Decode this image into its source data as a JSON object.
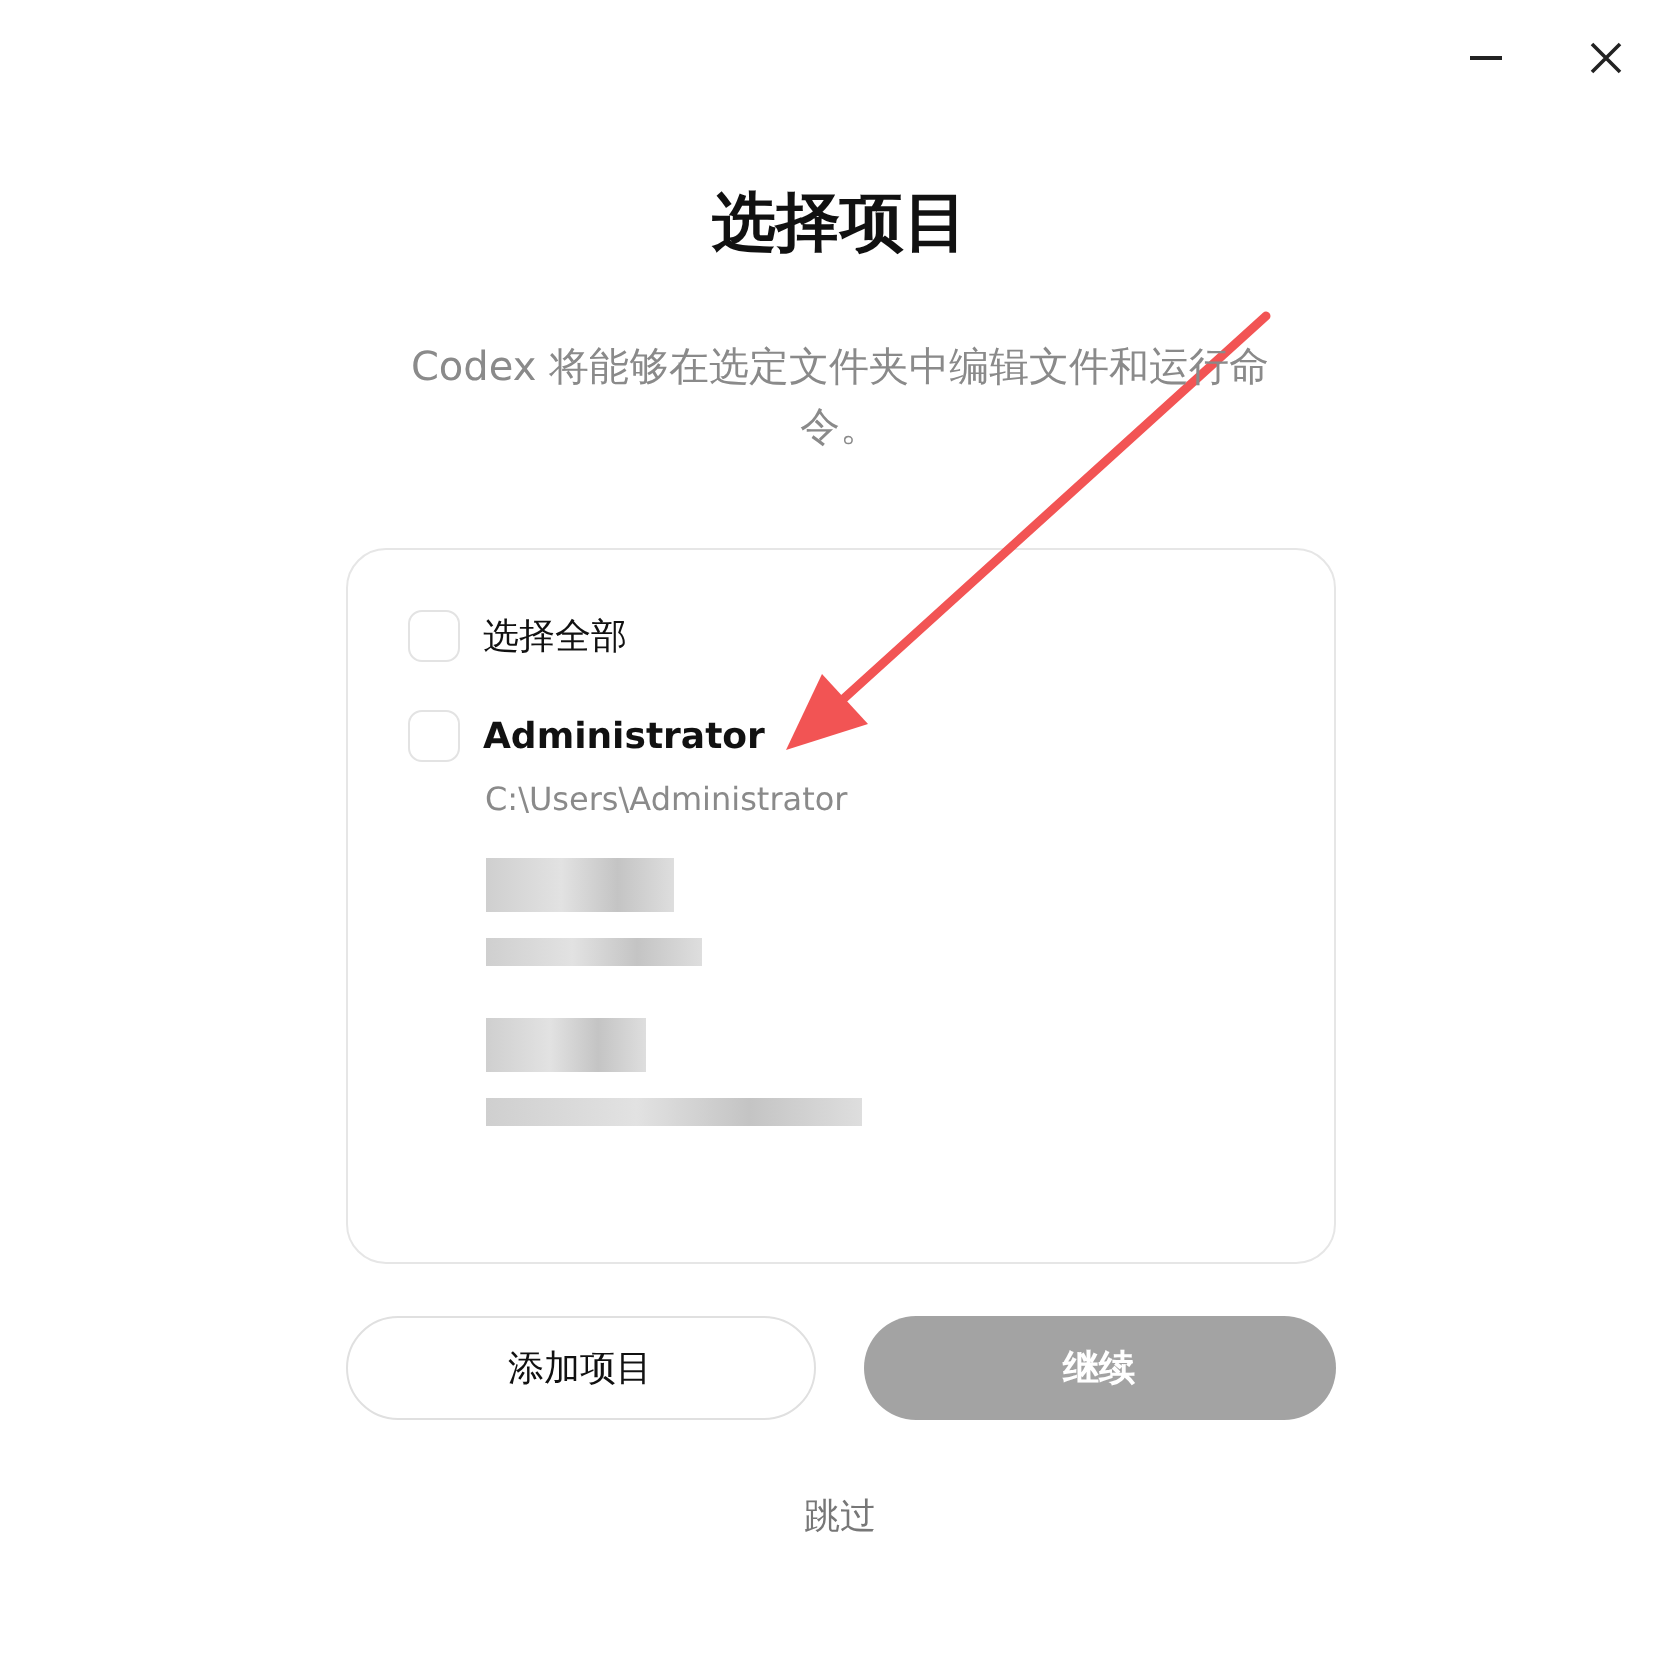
{
  "window_controls": [
    {
      "kind": "minimize"
    },
    {
      "kind": "close"
    }
  ],
  "title": "选择项目",
  "subtitle": "Codex 将能够在选定文件夹中编辑文件和运行命令。",
  "select_all": {
    "label": "选择全部",
    "checked": false
  },
  "folders": [
    {
      "kind": "folder",
      "name": "Administrator",
      "path": "C:\\Users\\Administrator",
      "checked": false
    },
    {
      "kind": "redacted"
    },
    {
      "kind": "redacted"
    }
  ],
  "buttons": [
    {
      "label": "添加项目",
      "primary": false
    },
    {
      "label": "继续",
      "disabled": true,
      "primary": true
    }
  ],
  "skip_link": "跳过"
}
